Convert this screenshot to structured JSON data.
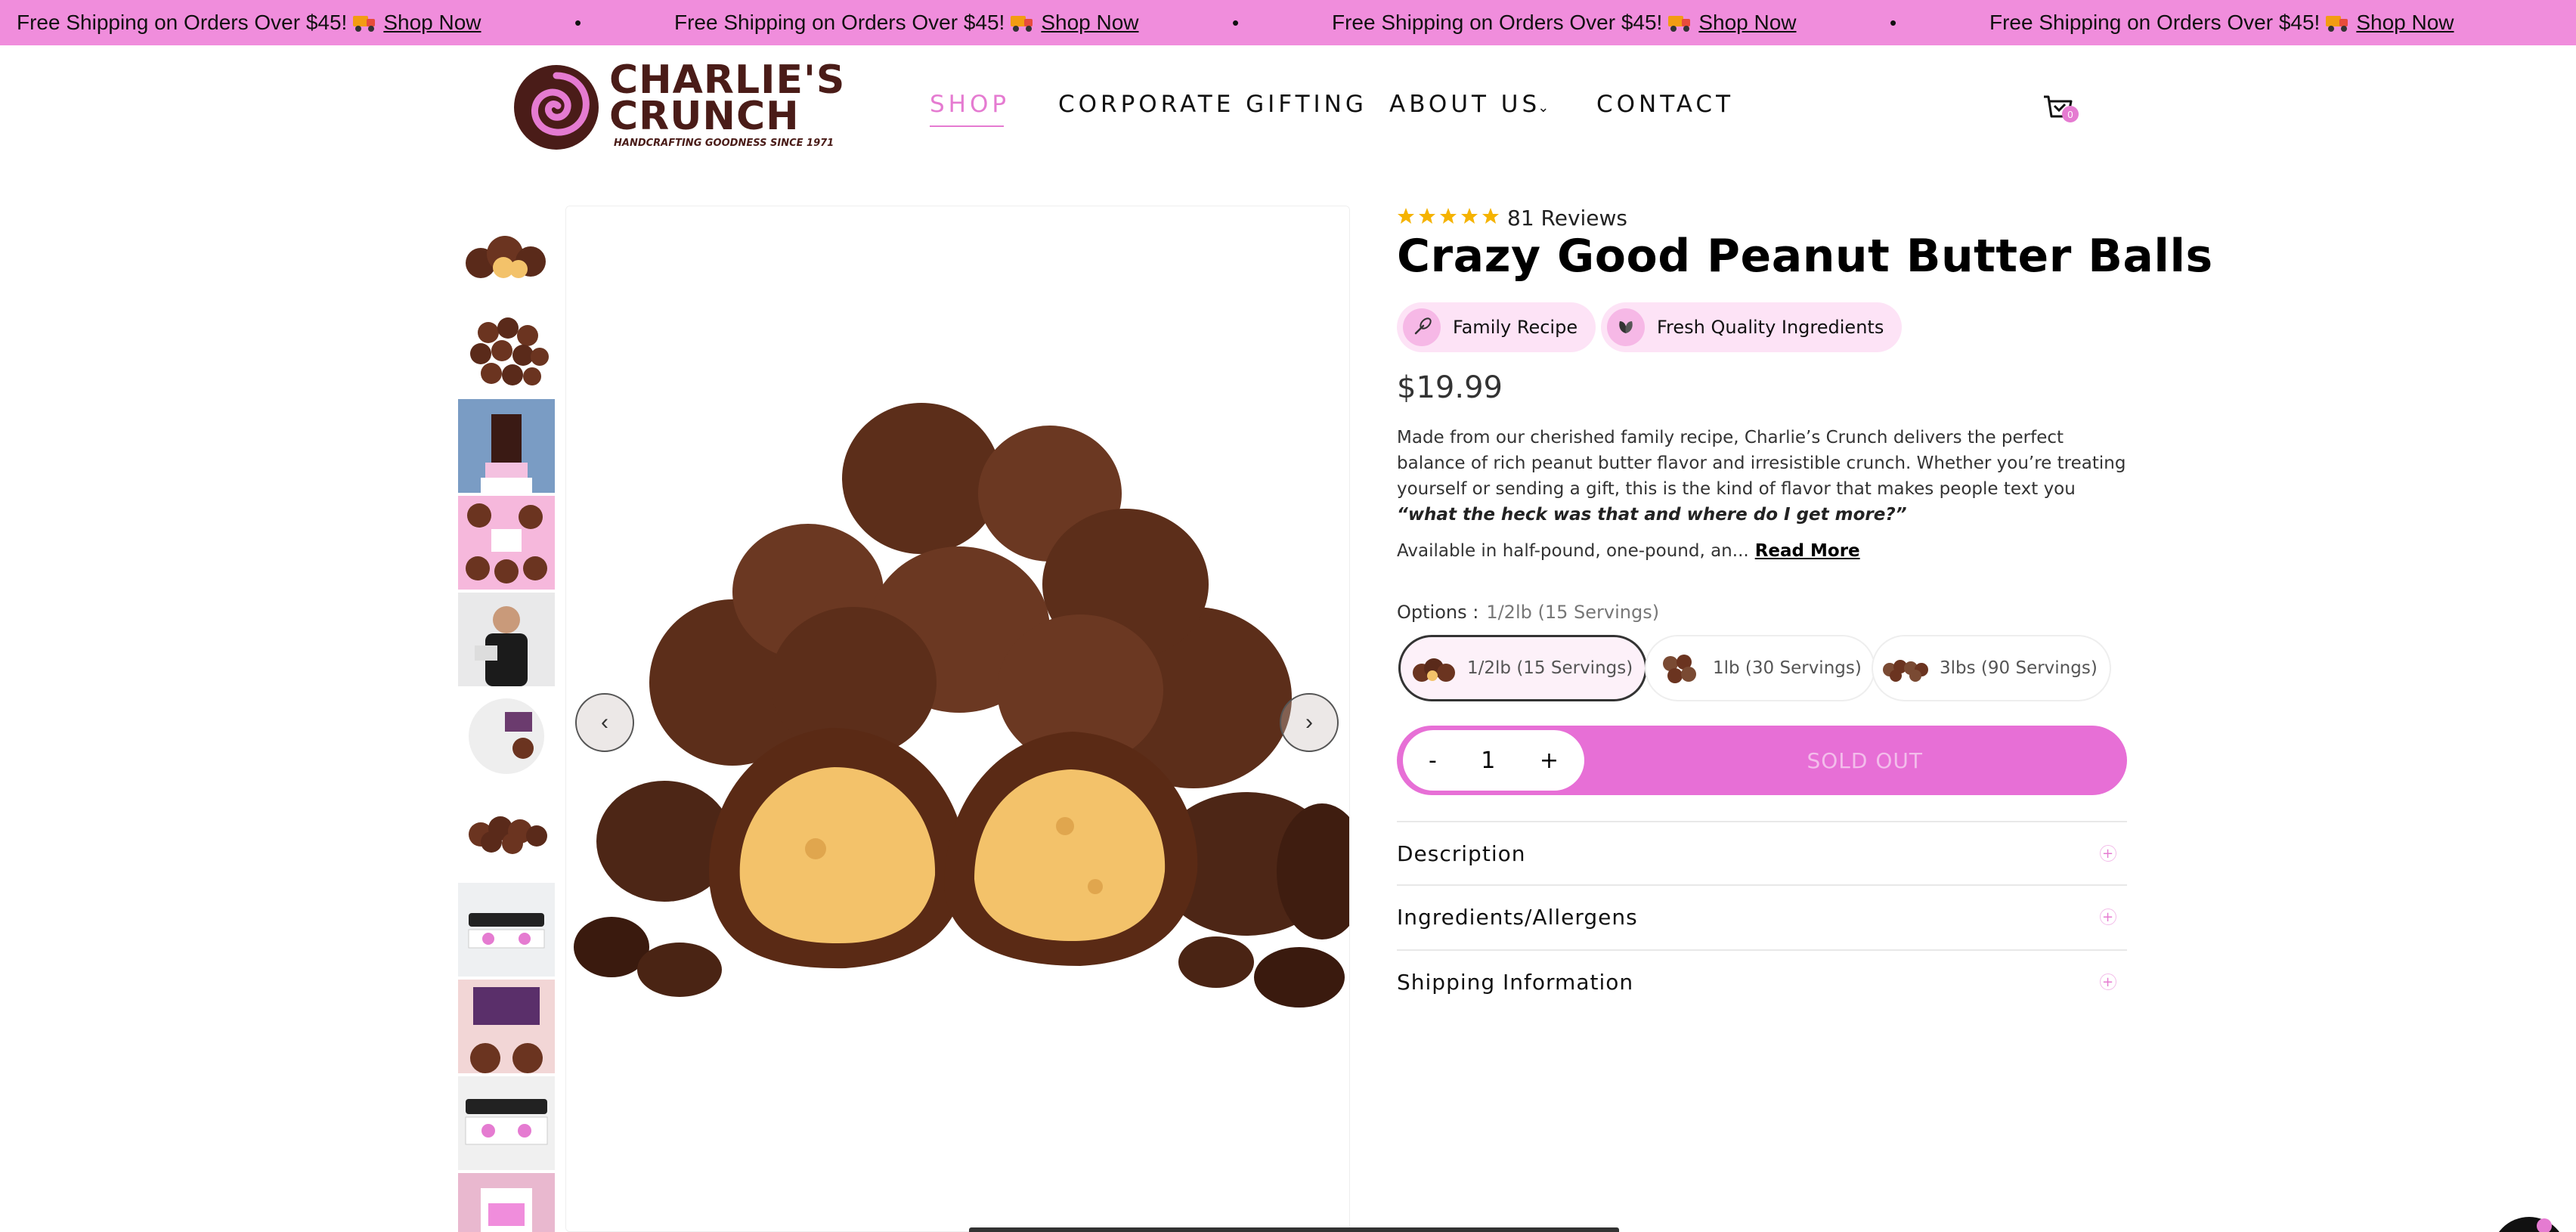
{
  "announcement": {
    "text": "Free Shipping on Orders Over $45!",
    "link": "Shop Now",
    "separator": "•"
  },
  "logo": {
    "line1": "CHARLIE'S",
    "line2": "CRUNCH",
    "tagline": "HANDCRAFTING GOODNESS SINCE 1971"
  },
  "nav": {
    "items": [
      "SHOP",
      "CORPORATE GIFTING",
      "ABOUT US",
      "CONTACT"
    ],
    "about_chevron": "⌄",
    "cart_count": "0"
  },
  "product": {
    "rating": 5,
    "reviews": "81 Reviews",
    "title": "Crazy Good Peanut Butter Balls",
    "badges": [
      "Family Recipe",
      "Fresh Quality Ingredients"
    ],
    "price": "$19.99",
    "description_plain": "Made from our cherished family recipe, Charlie’s Crunch delivers the perfect balance of rich peanut butter flavor and irresistible crunch. Whether you’re treating yourself or sending a gift, this is the kind of flavor that makes people text you ",
    "description_quote": "“what the heck was that and where do I get more?”",
    "availability": "Available in half-pound, one-pound, an...",
    "read_more": "Read More",
    "options_label": "Options :",
    "options_selected": "1/2lb (15 Servings)",
    "options": [
      "1/2lb (15 Servings)",
      "1lb (30 Servings)",
      "3lbs (90 Servings)"
    ],
    "qty_minus": "-",
    "qty_value": "1",
    "qty_plus": "+",
    "cta": "SOLD OUT",
    "accordions": [
      "Description",
      "Ingredients/Allergens",
      "Shipping Information"
    ],
    "accordion_icon": "+"
  },
  "gallery": {
    "prev": "‹",
    "next": "›",
    "thumb_count": 11
  },
  "colors": {
    "brand_pink": "#f08ddc",
    "cta_pink": "#e76fd6",
    "brand_brown": "#4a1c18",
    "star": "#f5b301"
  }
}
